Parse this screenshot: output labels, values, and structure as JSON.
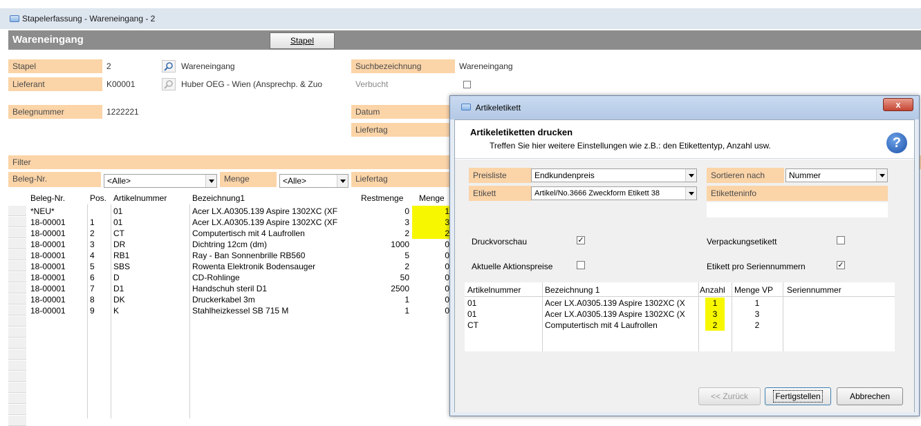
{
  "window": {
    "title": "Stapelerfassung - Wareneingang - 2"
  },
  "header": {
    "title": "Wareneingang",
    "stapel_button": "Stapel"
  },
  "form": {
    "stapel": {
      "label": "Stapel",
      "value": "2",
      "desc": "Wareneingang"
    },
    "lieferant": {
      "label": "Lieferant",
      "value": "K00001",
      "desc": "Huber OEG - Wien (Ansprechp. & Zuo"
    },
    "suchbezeichnung": {
      "label": "Suchbezeichnung",
      "value": "Wareneingang"
    },
    "verbucht": {
      "label": "Verbucht"
    },
    "belegnummer": {
      "label": "Belegnummer",
      "value": "1222221"
    },
    "datum": {
      "label": "Datum"
    },
    "liefertag": {
      "label": "Liefertag"
    }
  },
  "filter": {
    "title": "Filter",
    "beleg_label": "Beleg-Nr.",
    "beleg_value": "<Alle>",
    "menge_label": "Menge",
    "menge_value": "<Alle>",
    "liefertag_label": "Liefertag"
  },
  "grid": {
    "columns": [
      "Beleg-Nr.",
      "Pos.",
      "Artikelnummer",
      "Bezeichnung1",
      "Restmenge",
      "Menge"
    ],
    "rows": [
      {
        "beleg": "*NEU*",
        "pos": "",
        "art": "01",
        "bez": "Acer LX.A0305.139 Aspire 1302XC (XF",
        "rest": "0",
        "menge": "1",
        "hl": true
      },
      {
        "beleg": "18-00001",
        "pos": "1",
        "art": "01",
        "bez": "Acer LX.A0305.139 Aspire 1302XC (XF",
        "rest": "3",
        "menge": "3",
        "hl": true
      },
      {
        "beleg": "18-00001",
        "pos": "2",
        "art": "CT",
        "bez": "Computertisch mit 4 Laufrollen",
        "rest": "2",
        "menge": "2",
        "hl": true
      },
      {
        "beleg": "18-00001",
        "pos": "3",
        "art": "DR",
        "bez": "Dichtring 12cm (dm)",
        "rest": "1000",
        "menge": "0",
        "hl": false
      },
      {
        "beleg": "18-00001",
        "pos": "4",
        "art": "RB1",
        "bez": "Ray - Ban Sonnenbrille RB560",
        "rest": "5",
        "menge": "0",
        "hl": false
      },
      {
        "beleg": "18-00001",
        "pos": "5",
        "art": "SBS",
        "bez": "Rowenta Elektronik Bodensauger",
        "rest": "2",
        "menge": "0",
        "hl": false
      },
      {
        "beleg": "18-00001",
        "pos": "6",
        "art": "D",
        "bez": "CD-Rohlinge",
        "rest": "50",
        "menge": "0",
        "hl": false
      },
      {
        "beleg": "18-00001",
        "pos": "7",
        "art": "D1",
        "bez": "Handschuh steril D1",
        "rest": "2500",
        "menge": "0",
        "hl": false
      },
      {
        "beleg": "18-00001",
        "pos": "8",
        "art": "DK",
        "bez": "Druckerkabel 3m",
        "rest": "1",
        "menge": "0",
        "hl": false
      },
      {
        "beleg": "18-00001",
        "pos": "9",
        "art": "K",
        "bez": "Stahlheizkessel SB 715 M",
        "rest": "1",
        "menge": "0",
        "hl": false
      }
    ]
  },
  "dialog": {
    "title": "Artikeletikett",
    "close": "x",
    "heading": "Artikeletiketten drucken",
    "subtitle": "Treffen Sie hier weitere Einstellungen wie z.B.: den Etikettentyp, Anzahl usw.",
    "help": "?",
    "preisliste": {
      "label": "Preisliste",
      "value": "Endkundenpreis"
    },
    "etikett": {
      "label": "Etikett",
      "value": "Artikel/No.3666 Zweckform Etikett 38"
    },
    "sortieren": {
      "label": "Sortieren nach",
      "value": "Nummer"
    },
    "etiketteninfo": {
      "label": "Etiketteninfo"
    },
    "druckvorschau": {
      "label": "Druckvorschau",
      "check": "✓"
    },
    "aktionspreise": {
      "label": "Aktuelle Aktionspreise"
    },
    "verpackung": {
      "label": "Verpackungsetikett"
    },
    "seriennummern": {
      "label": "Etikett pro Seriennummern",
      "check": "✓"
    },
    "table": {
      "columns": [
        "Artikelnummer",
        "Bezeichnung 1",
        "Anzahl",
        "Menge VP",
        "Seriennummer"
      ],
      "rows": [
        {
          "art": "01",
          "bez": "Acer LX.A0305.139 Aspire 1302XC (X",
          "anzahl": "1",
          "vp": "1"
        },
        {
          "art": "01",
          "bez": "Acer LX.A0305.139 Aspire 1302XC (X",
          "anzahl": "3",
          "vp": "3"
        },
        {
          "art": "CT",
          "bez": "Computertisch mit 4 Laufrollen",
          "anzahl": "2",
          "vp": "2"
        }
      ]
    },
    "buttons": {
      "back": "<< Zurück",
      "finish": "Fertigstellen",
      "cancel": "Abbrechen"
    }
  }
}
